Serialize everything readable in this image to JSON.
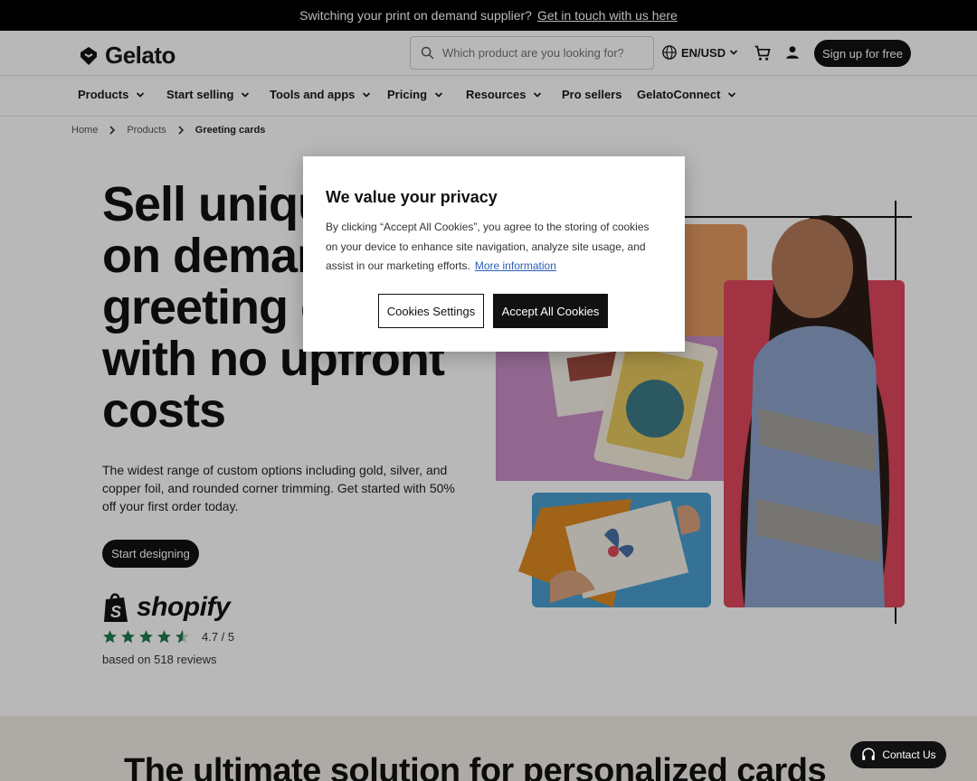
{
  "promo": {
    "text": "Switching your print on demand supplier?",
    "link": "Get in touch with us here"
  },
  "header": {
    "brand": "Gelato",
    "search_placeholder": "Which product are you looking for?",
    "locale": "EN/USD",
    "signup": "Sign up for free"
  },
  "nav": [
    {
      "label": "Products"
    },
    {
      "label": "Start selling"
    },
    {
      "label": "Tools and apps"
    },
    {
      "label": "Pricing"
    },
    {
      "label": "Resources"
    },
    {
      "label": "Pro sellers"
    },
    {
      "label": "GelatoConnect"
    }
  ],
  "breadcrumb": [
    "Home",
    "Products",
    "Greeting cards"
  ],
  "hero": {
    "title": "Sell unique print on demand greeting cards with no upfront costs",
    "description": "The widest range of custom options including gold, silver, and copper foil, and rounded corner trimming. Get started with 50% off your first order today.",
    "cta": "Start designing",
    "rating_brand": "shopify",
    "rating": "4.7 / 5",
    "rating_value": 4.7,
    "reviews": "based on 518 reviews"
  },
  "section": {
    "heading": "The ultimate solution for personalized cards"
  },
  "cookie_modal": {
    "title": "We value your privacy",
    "body": "By clicking “Accept All Cookies”, you agree to the storing of cookies on your device to enhance site navigation, analyze site usage, and assist in our marketing efforts.",
    "more": "More information",
    "settings": "Cookies Settings",
    "accept": "Accept All Cookies"
  },
  "contact": "Contact Us",
  "colors": {
    "star": "#1f7a4f",
    "accent_dark": "#111111",
    "band": "#f2eee6",
    "link": "#2b5cb8"
  }
}
